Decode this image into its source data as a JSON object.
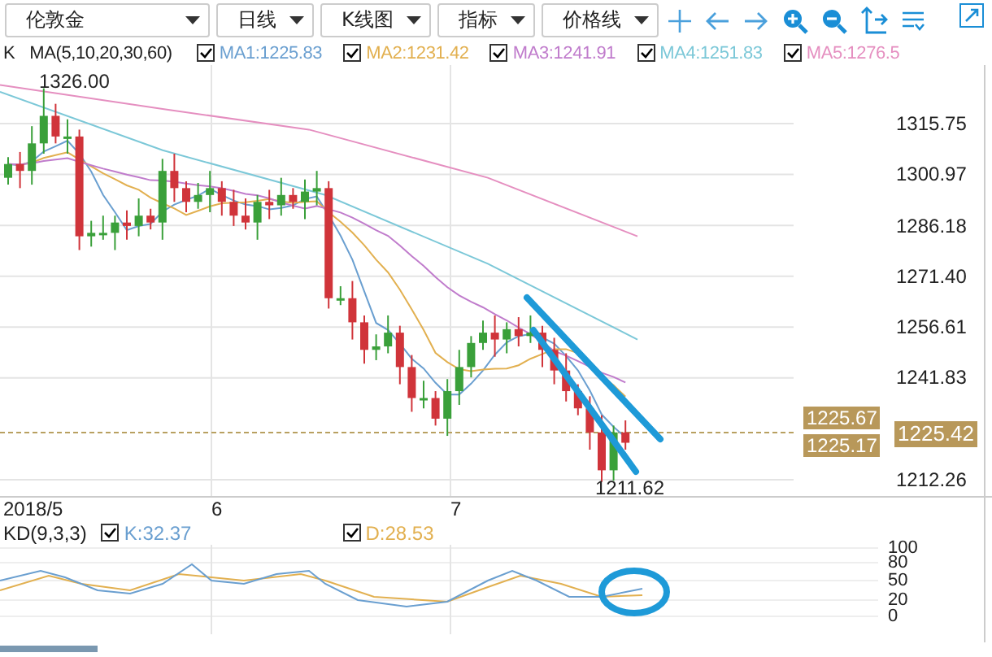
{
  "toolbar": {
    "dropdowns": [
      {
        "label": "伦敦金"
      },
      {
        "label": "日线"
      },
      {
        "label": "K线图"
      },
      {
        "label": "指标"
      },
      {
        "label": "价格线"
      }
    ]
  },
  "legend": {
    "label": "K",
    "formula": "MA(5,10,20,30,60)",
    "items": [
      {
        "label": "MA1:1225.83",
        "checked": true,
        "color": "#6a9fd0"
      },
      {
        "label": "MA2:1231.42",
        "checked": true,
        "color": "#e2b050"
      },
      {
        "label": "MA3:1241.91",
        "checked": true,
        "color": "#c07ccc"
      },
      {
        "label": "MA4:1251.83",
        "checked": true,
        "color": "#7cc8d8"
      },
      {
        "label": "MA5:1276.5",
        "checked": true,
        "color": "#e58fc0"
      }
    ]
  },
  "price_chart": {
    "high_label": "1326.00",
    "low_label": "1211.62",
    "y_axis_labels": [
      "1315.75",
      "1300.97",
      "1286.18",
      "1271.40",
      "1256.61",
      "1241.83",
      "1212.26"
    ],
    "price_tags": [
      {
        "label": "1225.67"
      },
      {
        "label": "1225.17"
      }
    ],
    "current_price": "1225.42",
    "x_axis_labels": [
      "2018/5",
      "6",
      "7"
    ]
  },
  "kd_panel": {
    "title": "KD(9,3,3)",
    "items": [
      {
        "label": "K:32.37",
        "checked": true,
        "color": "#6a9fd0"
      },
      {
        "label": "D:28.53",
        "checked": true,
        "color": "#e2b050"
      }
    ],
    "y_axis_labels": [
      "100",
      "80",
      "50",
      "20",
      "0"
    ]
  }
}
